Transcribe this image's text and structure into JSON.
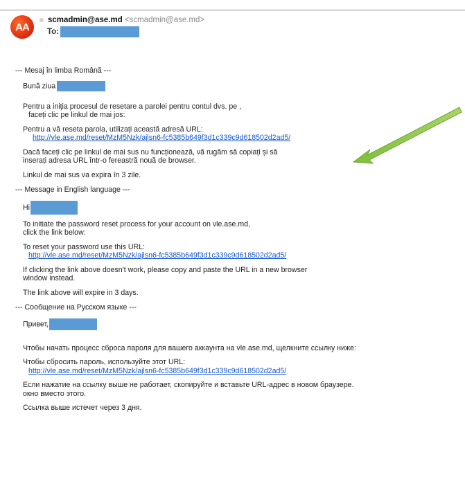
{
  "header": {
    "sender_name": "scmadmin@ase.md",
    "sender_addr": "<scmadmin@ase.md>",
    "to_label": "To:",
    "avatar_initials": "AA"
  },
  "ro": {
    "sep": "--- Mesaj în limba Română ---",
    "greet": "Bună ziua",
    "p1a": "Pentru a iniția procesul de resetare a parolei pentru contul dvs. pe ,",
    "p1b": "faceți clic pe linkul de mai jos:",
    "p2": "Pentru a vă reseta parola, utilizați această adresă URL:",
    "url": "http://vle.ase.md/reset/MzM5Nzk/ajlsn6-fc5385b649f3d1c339c9d618502d2ad5/",
    "p3a": "Dacă faceți clic pe linkul de mai sus nu funcționează, vă rugăm să copiați și să",
    "p3b": "inserați adresa URL într-o fereastră nouă de browser.",
    "p4": "Linkul de mai sus va expira în 3 zile."
  },
  "en": {
    "sep": "--- Message in English language ---",
    "greet": "Hi",
    "p1a": "To initiate the password reset process for your account on vle.ase.md,",
    "p1b": "click the link below:",
    "p2": "To reset your password use this URL:",
    "url": "http://vle.ase.md/reset/MzM5Nzk/ajlsn6-fc5385b649f3d1c339c9d618502d2ad5/",
    "p3a": "If clicking the link above doesn't work, please copy and paste the URL in a new browser",
    "p3b": "window instead.",
    "p4": "The link above will expire in 3 days."
  },
  "ru": {
    "sep": "--- Сообщение на Русском языке ---",
    "greet": "Привет,",
    "p1": "Чтобы начать процесс сброса пароля для вашего аккаунта на vle.ase.md, щелкните ссылку ниже:",
    "p2": "Чтобы сбросить пароль, используйте этот URL:",
    "url": "http://vle.ase.md/reset/MzM5Nzk/ajlsn6-fc5385b649f3d1c339c9d618502d2ad5/",
    "p3a": "Если нажатие на ссылку выше не работает, скопируйте и вставьте URL-адрес в новом браузере.",
    "p3b": "окно вместо этого.",
    "p4": "Ссылка выше истечет через 3 дня."
  },
  "colors": {
    "link": "#1155cc",
    "redaction": "#5b9bd5",
    "arrow": "#8dc63f",
    "avatar": "#e0401a"
  }
}
